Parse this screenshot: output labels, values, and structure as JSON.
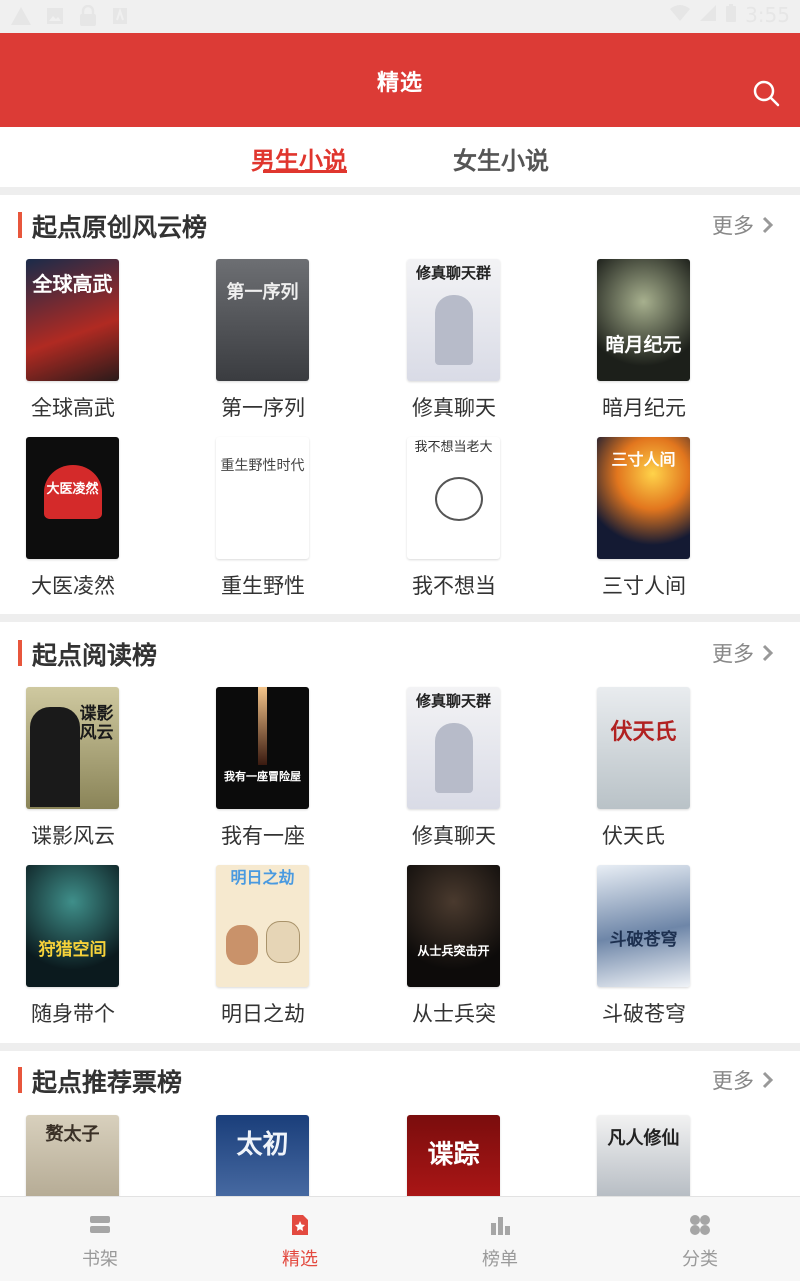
{
  "status_bar": {
    "time": "3:55"
  },
  "header": {
    "title": "精选"
  },
  "tabs": [
    {
      "label": "男生小说",
      "active": true
    },
    {
      "label": "女生小说",
      "active": false
    }
  ],
  "sections": [
    {
      "title": "起点原创风云榜",
      "more": "更多",
      "books": [
        {
          "title": "全球高武",
          "cover_text": "全球高武"
        },
        {
          "title": "第一序列",
          "cover_text": "第一序列"
        },
        {
          "title": "修真聊天",
          "cover_text": "修真聊天群"
        },
        {
          "title": "暗月纪元",
          "cover_text": "暗月纪元"
        },
        {
          "title": "大医凌然",
          "cover_text": "大医凌然"
        },
        {
          "title": "重生野性",
          "cover_text": "重生野性时代"
        },
        {
          "title": "我不想当",
          "cover_text": "我不想当老大"
        },
        {
          "title": "三寸人间",
          "cover_text": "三寸人间"
        }
      ]
    },
    {
      "title": "起点阅读榜",
      "more": "更多",
      "books": [
        {
          "title": "谍影风云",
          "cover_text": "谍影风云"
        },
        {
          "title": "我有一座",
          "cover_text": "我有一座冒险屋"
        },
        {
          "title": "修真聊天",
          "cover_text": "修真聊天群"
        },
        {
          "title": "伏天氏",
          "cover_text": "伏天氏"
        },
        {
          "title": "随身带个",
          "cover_text": "狩猎空间"
        },
        {
          "title": "明日之劫",
          "cover_text": "明日之劫"
        },
        {
          "title": "从士兵突",
          "cover_text": "从士兵突击开"
        },
        {
          "title": "斗破苍穹",
          "cover_text": "斗破苍穹"
        }
      ]
    },
    {
      "title": "起点推荐票榜",
      "more": "更多",
      "books": [
        {
          "title": "",
          "cover_text": "赘太子"
        },
        {
          "title": "",
          "cover_text": "太初"
        },
        {
          "title": "",
          "cover_text": "谍踪"
        },
        {
          "title": "",
          "cover_text": "凡人修仙"
        }
      ]
    }
  ],
  "bottom_nav": [
    {
      "label": "书架",
      "icon": "bookshelf-icon",
      "active": false
    },
    {
      "label": "精选",
      "icon": "featured-icon",
      "active": true
    },
    {
      "label": "榜单",
      "icon": "rankings-icon",
      "active": false
    },
    {
      "label": "分类",
      "icon": "category-icon",
      "active": false
    }
  ],
  "colors": {
    "brand_red": "#dc3b36",
    "tab_active": "#e0362e",
    "section_accent": "#e8563c"
  }
}
